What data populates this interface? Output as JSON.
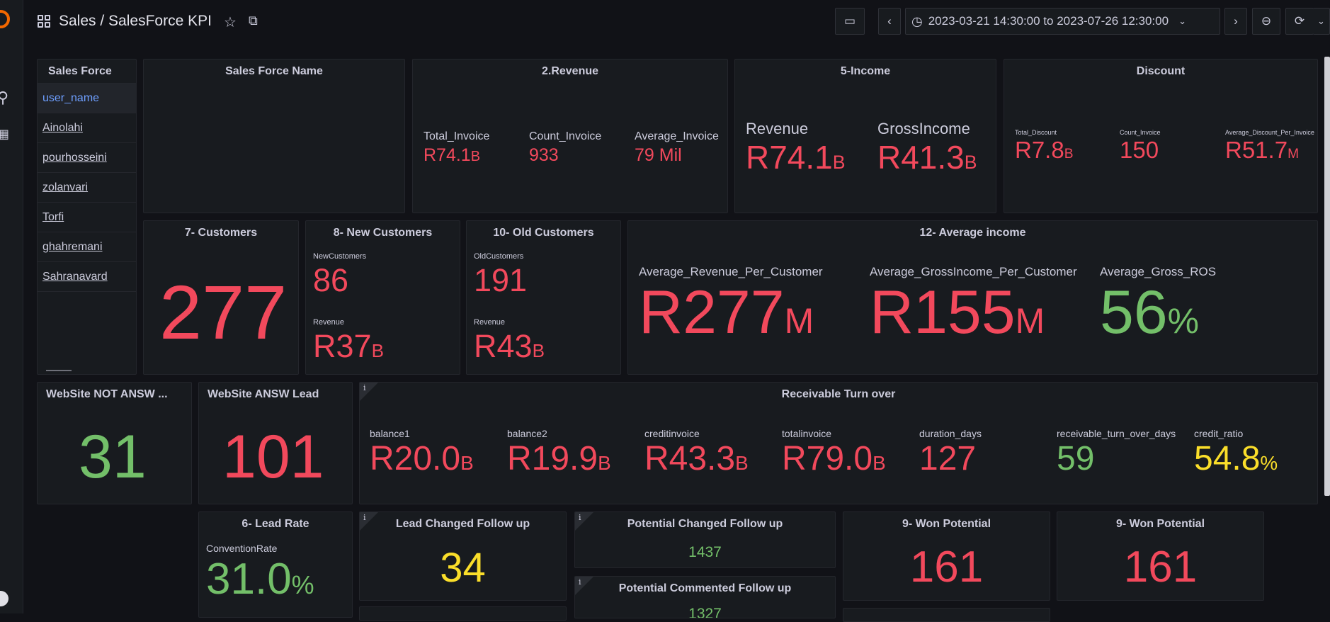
{
  "topbar": {
    "title": "Sales / SalesForce KPI",
    "time_range": "2023-03-21 14:30:00 to 2023-07-26 12:30:00"
  },
  "colors": {
    "red": "#f2495c",
    "green": "#73bf69",
    "yellow": "#fade2a",
    "panel": "#181b1f",
    "bg": "#111217"
  },
  "sales_force": {
    "header": "Sales Force",
    "rows": [
      "user_name",
      "Ainolahi",
      "pourhosseini",
      "zolanvari",
      "Torfi",
      "ghahremani",
      "Sahranavard"
    ]
  },
  "panels": {
    "sales_force_name": {
      "title": "Sales Force Name"
    },
    "revenue": {
      "title": "2.Revenue",
      "stats": [
        {
          "label": "Total_Invoice",
          "value": "R74.1",
          "unit": "B"
        },
        {
          "label": "Count_Invoice",
          "value": "933",
          "unit": ""
        },
        {
          "label": "Average_Invoice",
          "value": "79 Mil",
          "unit": ""
        }
      ]
    },
    "income": {
      "title": "5-Income",
      "stats": [
        {
          "label": "Revenue",
          "value": "R74.1",
          "unit": "B"
        },
        {
          "label": "GrossIncome",
          "value": "R41.3",
          "unit": "B"
        }
      ]
    },
    "discount": {
      "title": "Discount",
      "stats": [
        {
          "label": "Total_Discount",
          "value": "R7.8",
          "unit": "B"
        },
        {
          "label": "Count_Invoice",
          "value": "150",
          "unit": ""
        },
        {
          "label": "Average_Discount_Per_Invoice",
          "value": "R51.7",
          "unit": "M"
        }
      ]
    },
    "customers": {
      "title": "7- Customers",
      "value": "277"
    },
    "new_customers": {
      "title": "8- New Customers",
      "count_label": "NewCustomers",
      "count": "86",
      "revenue_label": "Revenue",
      "revenue": "R37",
      "revenue_unit": "B"
    },
    "old_customers": {
      "title": "10- Old Customers",
      "count_label": "OldCustomers",
      "count": "191",
      "revenue_label": "Revenue",
      "revenue": "R43",
      "revenue_unit": "B"
    },
    "avg_income": {
      "title": "12- Average income",
      "stats": [
        {
          "label": "Average_Revenue_Per_Customer",
          "value": "R277",
          "unit": "M"
        },
        {
          "label": "Average_GrossIncome_Per_Customer",
          "value": "R155",
          "unit": "M"
        },
        {
          "label": "Average_Gross_ROS",
          "value": "56",
          "unit": "%"
        }
      ]
    },
    "website_not_answ": {
      "title": "WebSite NOT ANSW ...",
      "value": "31"
    },
    "website_answ": {
      "title": "WebSite ANSW Lead",
      "value": "101"
    },
    "receivable": {
      "title": "Receivable Turn over",
      "stats": [
        {
          "label": "balance1",
          "value": "R20.0",
          "unit": "B"
        },
        {
          "label": "balance2",
          "value": "R19.9",
          "unit": "B"
        },
        {
          "label": "creditinvoice",
          "value": "R43.3",
          "unit": "B"
        },
        {
          "label": "totalinvoice",
          "value": "R79.0",
          "unit": "B"
        },
        {
          "label": "duration_days",
          "value": "127",
          "unit": ""
        },
        {
          "label": "receivable_turn_over_days",
          "value": "59",
          "unit": ""
        },
        {
          "label": "credit_ratio",
          "value": "54.8",
          "unit": "%"
        }
      ]
    },
    "lead_rate": {
      "title": "6- Lead Rate",
      "label": "ConventionRate",
      "value": "31.0",
      "unit": "%"
    },
    "lead_changed": {
      "title": "Lead Changed Follow up",
      "value": "34"
    },
    "potential_changed": {
      "title": "Potential Changed Follow up",
      "value": "1437"
    },
    "potential_commented": {
      "title": "Potential Commented Follow up",
      "value": "1327"
    },
    "won_potential_1": {
      "title": "9- Won Potential",
      "value": "161"
    },
    "won_potential_2": {
      "title": "9- Won Potential",
      "value": "161"
    }
  }
}
